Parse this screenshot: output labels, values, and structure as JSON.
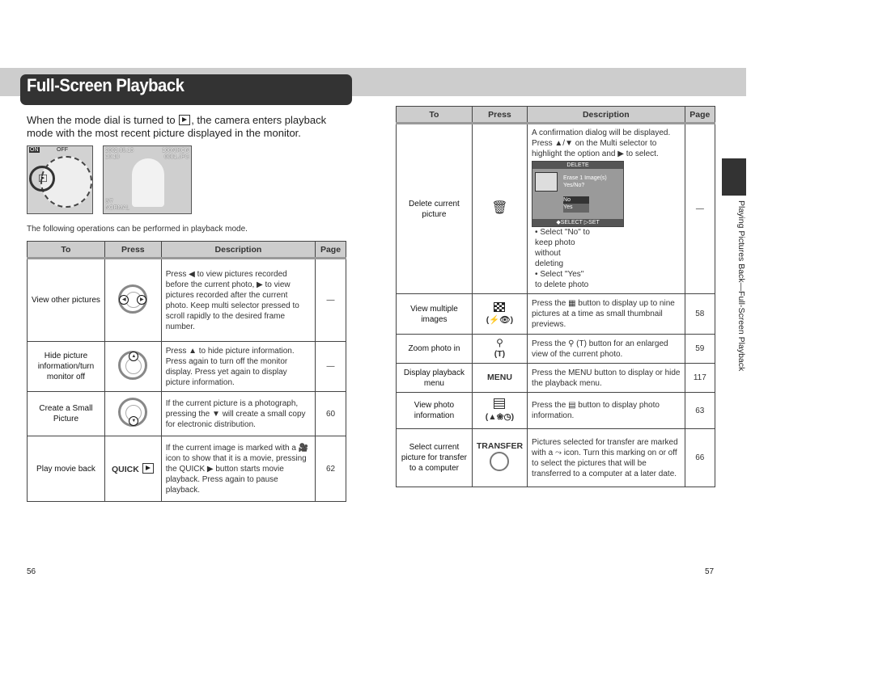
{
  "header": {
    "title": "Full-Screen Playback"
  },
  "intro": {
    "text_before": "When the mode dial is turned to",
    "text_after": ", the camera enters playback mode with the most recent picture displayed in the monitor.",
    "icon": "playback-icon"
  },
  "figures": {
    "dial_label_on": "ON",
    "dial_label_off": "OFF",
    "photo_date": "2002.08.15",
    "photo_time": "10:10",
    "photo_folder": "100NIKON",
    "photo_file": "0001.JPG",
    "photo_frames": "3/7",
    "photo_quality": "NORMAL"
  },
  "ops_intro": "The following operations can be performed in playback mode.",
  "table_headers": {
    "to": "To",
    "press": "Press",
    "description": "Description",
    "page": "Page"
  },
  "left_rows": [
    {
      "to": "View other pictures",
      "press_icon": "multi-selector-left-right-icon",
      "description": "Press ◀ to view pictures recorded before the current photo, ▶ to view pictures recorded after the current photo. Keep multi selector pressed to scroll rapidly to the desired frame number.",
      "page": "—"
    },
    {
      "to": "Hide picture information/turn monitor off",
      "press_icon": "multi-selector-up-icon",
      "description": "Press ▲ to hide picture information. Press again to turn off the monitor display. Press yet again to display picture information.",
      "page": "—"
    },
    {
      "to": "Create a Small Picture",
      "press_icon": "multi-selector-down-icon",
      "description": "If the current picture is a photograph, pressing the ▼ will create a small copy for electronic distribution.",
      "page": "60"
    },
    {
      "to": "Play movie back",
      "press": "QUICK",
      "press_icon": "playback-icon",
      "description": "If the current image is marked with a 🎥 icon to show that it is a movie, pressing the QUICK ▶ button starts movie playback. Press again to pause playback.",
      "page": "62"
    }
  ],
  "right_rows": [
    {
      "to": "Delete current picture",
      "press_icon": "trash-icon",
      "description": "A confirmation dialog will be displayed. Press ▲/▼ on the Multi selector to highlight the option and ▶ to select.",
      "dialog": {
        "title": "DELETE",
        "message": "Erase 1 Image(s) Yes/No?",
        "option_no": "No",
        "option_yes": "Yes",
        "footer": "◆SELECT ▷SET"
      },
      "bullets": [
        "• Select \"No\" to keep photo without deleting",
        "• Select \"Yes\" to delete photo"
      ],
      "page": "—"
    },
    {
      "to": "View multiple images",
      "press_icon": "thumbnail-grid-icon",
      "press_sub": "(⚡👁)",
      "description": "Press the ▦ button to display up to nine pictures at a time as small thumbnail previews.",
      "page": "58"
    },
    {
      "to": "Zoom photo in",
      "press_icon": "zoom-icon",
      "press_sub": "(T)",
      "description": "Press the ⚲ (T) button for an enlarged view of the current photo.",
      "page": "59"
    },
    {
      "to": "Display playback menu",
      "press": "MENU",
      "description": "Press the MENU button to display or hide the playback menu.",
      "page": "117"
    },
    {
      "to": "View photo information",
      "press_icon": "info-display-icon",
      "press_sub": "(▲❀◷)",
      "description": "Press the ▤ button to display photo information.",
      "page": "63"
    },
    {
      "to": "Select current picture for transfer to a computer",
      "press": "TRANSFER",
      "press_icon": "transfer-button-icon",
      "description": "Pictures selected for transfer are marked with a ⤳ icon. Turn this marking on or off to select the pictures that will be transferred to a computer at a later date.",
      "page": "66"
    }
  ],
  "side_label": "Playing Pictures Back—Full-Screen Playback",
  "page_numbers": {
    "left": "56",
    "right": "57"
  }
}
